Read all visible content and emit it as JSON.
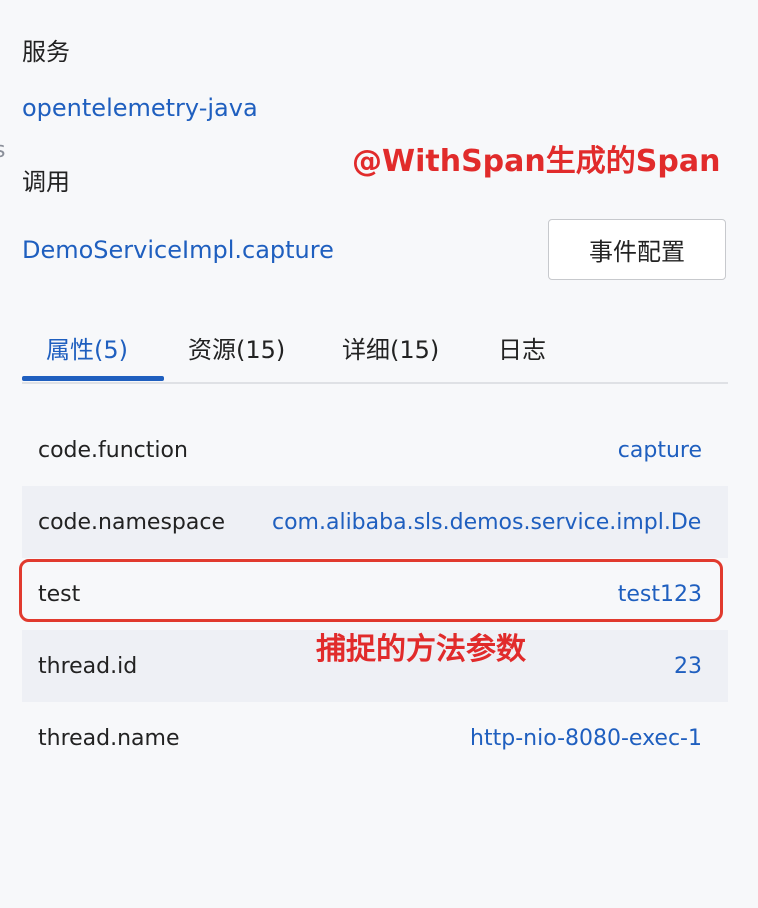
{
  "left_edge_char": "s",
  "service": {
    "label": "服务",
    "value": "opentelemetry-java"
  },
  "call": {
    "label": "调用",
    "value": "DemoServiceImpl.capture"
  },
  "annotations": {
    "withspan": "@WithSpan生成的Span",
    "captured_param": "捕捉的方法参数"
  },
  "event_config_button": "事件配置",
  "tabs": [
    {
      "label": "属性(5)",
      "active": true
    },
    {
      "label": "资源(15)",
      "active": false
    },
    {
      "label": "详细(15)",
      "active": false
    },
    {
      "label": "日志",
      "active": false
    }
  ],
  "attributes": [
    {
      "key": "code.function",
      "value": "capture"
    },
    {
      "key": "code.namespace",
      "value": "com.alibaba.sls.demos.service.impl.DemoServiceImpl"
    },
    {
      "key": "test",
      "value": "test123"
    },
    {
      "key": "thread.id",
      "value": "23"
    },
    {
      "key": "thread.name",
      "value": "http-nio-8080-exec-1"
    }
  ],
  "colors": {
    "link": "#1f5fbf",
    "annotation": "#e12b2b",
    "highlight_border": "#e13a2e"
  }
}
